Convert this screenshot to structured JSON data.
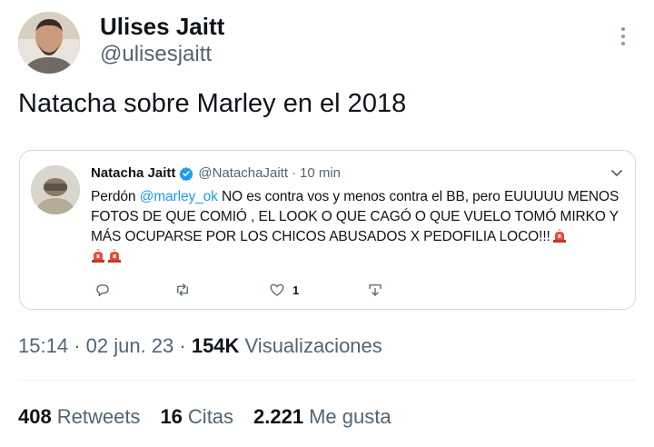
{
  "author": {
    "name": "Ulises Jaitt",
    "handle": "@ulisesjaitt"
  },
  "tweet": {
    "text": "Natacha sobre Marley en el 2018"
  },
  "quoted": {
    "name": "Natacha Jaitt",
    "handle": "@NatachaJaitt",
    "separator": "·",
    "time": "10 min",
    "body_part1": "Perdón ",
    "mention": "@marley_ok",
    "body_part2": " NO es contra vos y menos contra el BB, pero EUUUUU MENOS FOTOS DE QUE COMIÓ , EL LOOK O QUE CAGÓ O QUE VUELO TOMÓ MIRKO Y MÁS OCUPARSE POR LOS CHICOS ABUSADOS X PEDOFILIA LOCO!!!",
    "like_count": "1",
    "verified_color": "#1d9bf0",
    "icons": [
      "reply-icon",
      "retweet-icon",
      "like-icon",
      "share-icon",
      "siren-emoji",
      "verified-badge-icon",
      "chevron-down-icon"
    ]
  },
  "meta": {
    "time": "15:14",
    "sep1": " · ",
    "date": "02 jun. 23",
    "sep2": " · ",
    "views_count": "154K",
    "views_label": " Visualizaciones"
  },
  "stats": {
    "retweets_count": "408",
    "retweets_label": "Retweets",
    "quotes_count": "16",
    "quotes_label": "Citas",
    "likes_count": "2.221",
    "likes_label": "Me gusta"
  },
  "colors": {
    "text": "#0f1419",
    "secondary": "#536471",
    "accent": "#1d9bf0",
    "border": "#cfd9de"
  }
}
